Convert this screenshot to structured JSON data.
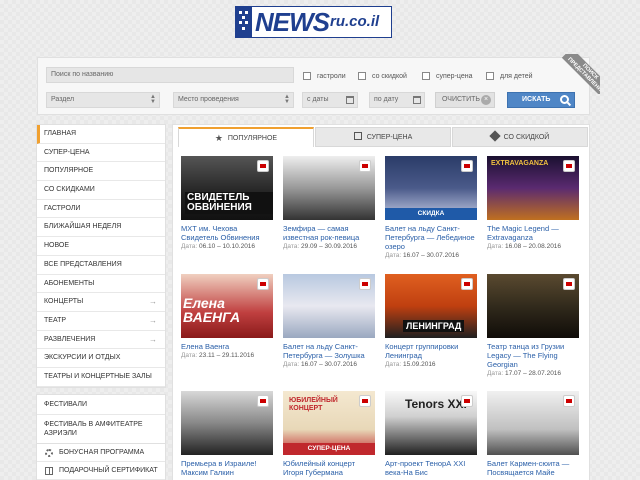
{
  "logo": {
    "news": "NEWS",
    "domain": "ru.co.il"
  },
  "search": {
    "name_placeholder": "Поиск по названию",
    "section_placeholder": "Раздел",
    "venue_placeholder": "Место проведения",
    "date_from_placeholder": "с даты",
    "date_to_placeholder": "по дату",
    "checkboxes": [
      "гастроли",
      "со скидкой",
      "супер-цена",
      "для детей"
    ],
    "clear_label": "ОЧИСТИТЬ",
    "search_label": "ИСКАТЬ",
    "ribbon_line1": "ПОИСК",
    "ribbon_line2": "ПРЕДСТАВЛЕНИЙ"
  },
  "sidebar": {
    "items": [
      {
        "label": "Главная",
        "arrow": false
      },
      {
        "label": "Супер-цена",
        "arrow": false
      },
      {
        "label": "Популярное",
        "arrow": false
      },
      {
        "label": "Со скидками",
        "arrow": false
      },
      {
        "label": "Гастроли",
        "arrow": false
      },
      {
        "label": "Ближайшая неделя",
        "arrow": false
      },
      {
        "label": "Новое",
        "arrow": false
      },
      {
        "label": "Все представления",
        "arrow": false
      },
      {
        "label": "Абонементы",
        "arrow": false
      },
      {
        "label": "Концерты",
        "arrow": true
      },
      {
        "label": "Театр",
        "arrow": true
      },
      {
        "label": "Развлечения",
        "arrow": true
      },
      {
        "label": "Экскурсии и отдых",
        "arrow": false
      },
      {
        "label": "Театры и концертные залы",
        "arrow": false
      }
    ],
    "festivals": [
      "Фестивали",
      "Фестиваль в амфитеатре Азриэли"
    ],
    "extras": [
      "Бонусная программа",
      "Подарочный сертификат"
    ]
  },
  "tabs": [
    "ПОПУЛЯРНОЕ",
    "СУПЕР-ЦЕНА",
    "СО СКИДКОЙ"
  ],
  "date_label": "Дата:",
  "cards": [
    {
      "title": "МХТ им. Чехова Свидетель Обвинения",
      "date": "06.10 – 10.10.2016",
      "tag": "",
      "img_text": "СВИДЕТЕЛЬ ОБВИНЕНИЯ"
    },
    {
      "title": "Земфира — самая известная рок-певица",
      "date": "29.09 – 30.09.2016",
      "tag": "",
      "img_text": ""
    },
    {
      "title": "Балет на льду Санкт-Петербурга — Лебединое озеро",
      "date": "16.07 – 30.07.2016",
      "tag": "СКИДКА",
      "img_text": ""
    },
    {
      "title": "The Magic Legend — Extravaganza",
      "date": "16.08 – 20.08.2016",
      "tag": "",
      "img_text": "EXTRAVAGANZA"
    },
    {
      "title": "Елена Ваенга",
      "date": "23.11 – 29.11.2016",
      "tag": "",
      "img_text": "Елена ВАЕНГА"
    },
    {
      "title": "Балет на льду Санкт-Петербурга — Золушка",
      "date": "16.07 – 30.07.2016",
      "tag": "",
      "img_text": ""
    },
    {
      "title": "Концерт группировки Ленинград",
      "date": "15.09.2016",
      "tag": "",
      "img_text": "ЛЕНИНГРАД"
    },
    {
      "title": "Театр танца из Грузии Legacy — The Flying Georgian",
      "date": "17.07 – 28.07.2016",
      "tag": "",
      "img_text": ""
    },
    {
      "title": "Премьера в Израиле! Максим Галкин",
      "date": "",
      "tag": "",
      "img_text": ""
    },
    {
      "title": "Юбилейный концерт Игоря Губермана",
      "date": "",
      "tag": "СУПЕР-ЦЕНА",
      "img_text": "ЮБИЛЕЙНЫЙ КОНЦЕРТ"
    },
    {
      "title": "Арт-проект ТенорА XXI века-На Бис",
      "date": "",
      "tag": "",
      "img_text": "Tenors XXI"
    },
    {
      "title": "Балет Кармен-сюита — Посвящается Майе",
      "date": "",
      "tag": "",
      "img_text": ""
    }
  ],
  "colors": {
    "accent": "#f0a030",
    "link": "#2a5fa8",
    "button": "#4f86c6",
    "brand": "#1f3f8f"
  }
}
